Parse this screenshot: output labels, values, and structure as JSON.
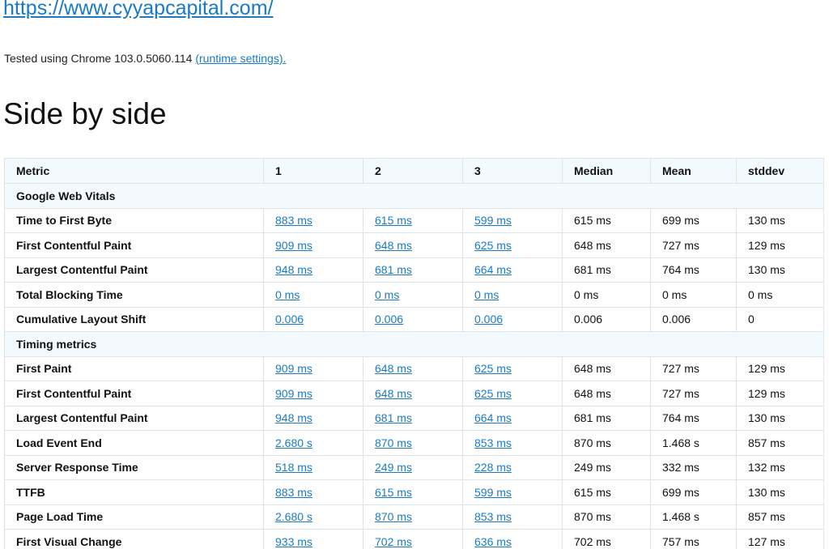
{
  "header": {
    "url": "https://www.cyyapcapital.com/",
    "tested_text": "Tested using Chrome 103.0.5060.114",
    "runtime_link": "(runtime settings)."
  },
  "page_title": "Side by side",
  "table": {
    "columns": [
      "Metric",
      "1",
      "2",
      "3",
      "Median",
      "Mean",
      "stddev"
    ],
    "sections": [
      {
        "title": "Google Web Vitals",
        "rows": [
          {
            "metric": "Time to First Byte",
            "runs": [
              "883 ms",
              "615 ms",
              "599 ms"
            ],
            "median": "615 ms",
            "mean": "699 ms",
            "stddev": "130 ms"
          },
          {
            "metric": "First Contentful Paint",
            "runs": [
              "909 ms",
              "648 ms",
              "625 ms"
            ],
            "median": "648 ms",
            "mean": "727 ms",
            "stddev": "129 ms"
          },
          {
            "metric": "Largest Contentful Paint",
            "runs": [
              "948 ms",
              "681 ms",
              "664 ms"
            ],
            "median": "681 ms",
            "mean": "764 ms",
            "stddev": "130 ms"
          },
          {
            "metric": "Total Blocking Time",
            "runs": [
              "0 ms",
              "0 ms",
              "0 ms"
            ],
            "median": "0 ms",
            "mean": "0 ms",
            "stddev": "0 ms"
          },
          {
            "metric": "Cumulative Layout Shift",
            "runs": [
              "0.006",
              "0.006",
              "0.006"
            ],
            "median": "0.006",
            "mean": "0.006",
            "stddev": "0"
          }
        ]
      },
      {
        "title": "Timing metrics",
        "rows": [
          {
            "metric": "First Paint",
            "runs": [
              "909 ms",
              "648 ms",
              "625 ms"
            ],
            "median": "648 ms",
            "mean": "727 ms",
            "stddev": "129 ms"
          },
          {
            "metric": "First Contentful Paint",
            "runs": [
              "909 ms",
              "648 ms",
              "625 ms"
            ],
            "median": "648 ms",
            "mean": "727 ms",
            "stddev": "129 ms"
          },
          {
            "metric": "Largest Contentful Paint",
            "runs": [
              "948 ms",
              "681 ms",
              "664 ms"
            ],
            "median": "681 ms",
            "mean": "764 ms",
            "stddev": "130 ms"
          },
          {
            "metric": "Load Event End",
            "runs": [
              "2.680 s",
              "870 ms",
              "853 ms"
            ],
            "median": "870 ms",
            "mean": "1.468 s",
            "stddev": "857 ms"
          },
          {
            "metric": "Server Response Time",
            "runs": [
              "518 ms",
              "249 ms",
              "228 ms"
            ],
            "median": "249 ms",
            "mean": "332 ms",
            "stddev": "132 ms"
          },
          {
            "metric": "TTFB",
            "runs": [
              "883 ms",
              "615 ms",
              "599 ms"
            ],
            "median": "615 ms",
            "mean": "699 ms",
            "stddev": "130 ms"
          },
          {
            "metric": "Page Load Time",
            "runs": [
              "2.680 s",
              "870 ms",
              "853 ms"
            ],
            "median": "870 ms",
            "mean": "1.468 s",
            "stddev": "857 ms"
          },
          {
            "metric": "First Visual Change",
            "runs": [
              "933 ms",
              "702 ms",
              "636 ms"
            ],
            "median": "702 ms",
            "mean": "757 ms",
            "stddev": "127 ms"
          }
        ]
      }
    ]
  }
}
